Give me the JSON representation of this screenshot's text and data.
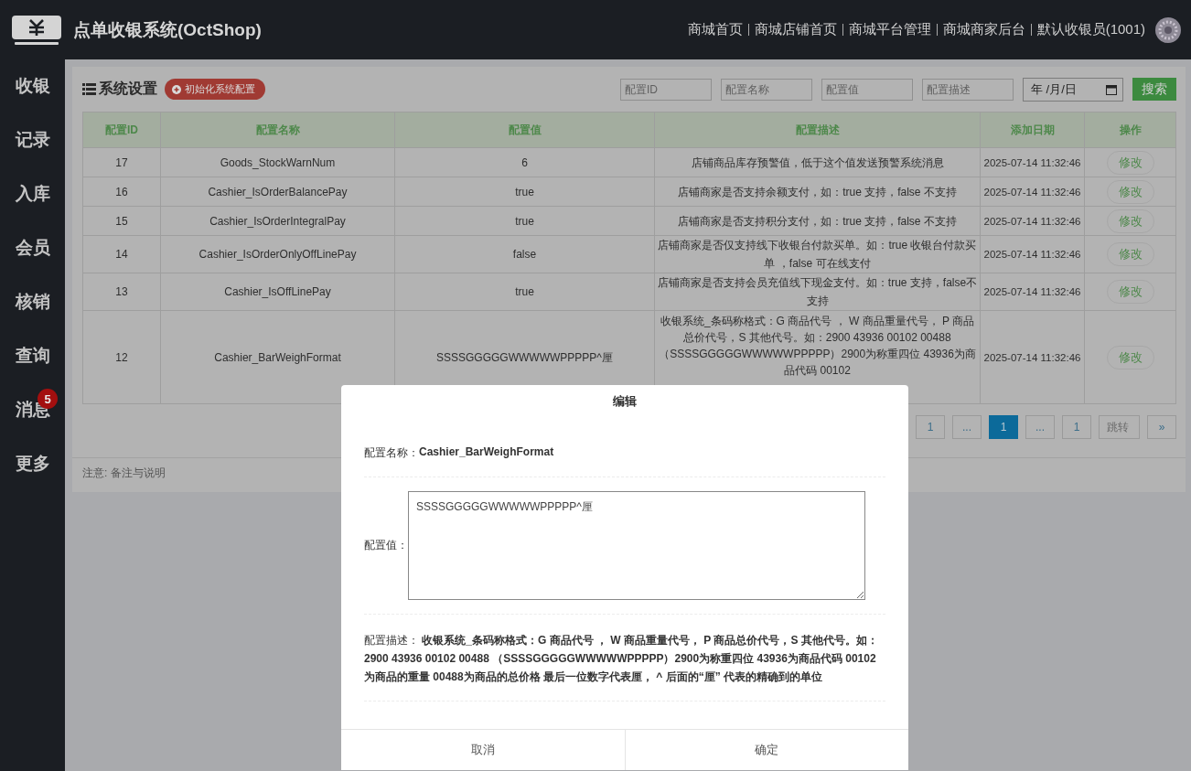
{
  "header": {
    "title": "点单收银系统(OctShop)",
    "nav": [
      "商城首页",
      "商城店铺首页",
      "商城平台管理",
      "商城商家后台",
      "默认收银员(1001)"
    ]
  },
  "sidebar": {
    "items": [
      {
        "label": "收银"
      },
      {
        "label": "记录"
      },
      {
        "label": "入库"
      },
      {
        "label": "会员"
      },
      {
        "label": "核销"
      },
      {
        "label": "查询"
      },
      {
        "label": "消息",
        "badge": "5"
      },
      {
        "label": "更多"
      }
    ]
  },
  "panel": {
    "title": "系统设置",
    "init_button": "初始化系统配置",
    "filters": [
      {
        "placeholder": "配置ID"
      },
      {
        "placeholder": "配置名称"
      },
      {
        "placeholder": "配置值"
      },
      {
        "placeholder": "配置描述"
      }
    ],
    "date_field": "年 /月/日",
    "search_button": "搜索"
  },
  "table": {
    "columns": [
      "配置ID",
      "配置名称",
      "配置值",
      "配置描述",
      "添加日期",
      "操作"
    ],
    "rows": [
      {
        "id": "17",
        "name": "Goods_StockWarnNum",
        "value": "6",
        "description": "店铺商品库存预警值，低于这个值发送预警系统消息",
        "date": "2025-07-14 11:32:46",
        "action": "修改"
      },
      {
        "id": "16",
        "name": "Cashier_IsOrderBalancePay",
        "value": "true",
        "description": "店铺商家是否支持余额支付，如：true 支持，false 不支持",
        "date": "2025-07-14 11:32:46",
        "action": "修改"
      },
      {
        "id": "15",
        "name": "Cashier_IsOrderIntegralPay",
        "value": "true",
        "description": "店铺商家是否支持积分支付，如：true 支持，false 不支持",
        "date": "2025-07-14 11:32:46",
        "action": "修改"
      },
      {
        "id": "14",
        "name": "Cashier_IsOrderOnlyOffLinePay",
        "value": "false",
        "description": "店铺商家是否仅支持线下收银台付款买单。如：true 收银台付款买单 ，false 可在线支付",
        "date": "2025-07-14 11:32:46",
        "action": "修改"
      },
      {
        "id": "13",
        "name": "Cashier_IsOffLinePay",
        "value": "true",
        "description": "店铺商家是否支持会员充值线下现金支付。如：true 支持，false不支持",
        "date": "2025-07-14 11:32:46",
        "action": "修改"
      },
      {
        "id": "12",
        "name": "Cashier_BarWeighFormat",
        "value": "SSSSGGGGGWWWWWPPPPP^厘",
        "description": "收银系统_条码称格式：G 商品代号 ， W 商品重量代号， P 商品总价代号，S 其他代号。如：2900 43936 00102 00488 （SSSSGGGGGWWWWWPPPPP）2900为称重四位 43936为商品代码 00102",
        "date": "2025-07-14 11:32:46",
        "action": "修改"
      }
    ]
  },
  "pagination": [
    {
      "label": "1",
      "selected": false
    },
    {
      "label": "...",
      "selected": false
    },
    {
      "label": "1",
      "selected": true
    },
    {
      "label": "...",
      "selected": false
    },
    {
      "label": "1",
      "selected": false
    },
    {
      "label": "跳转",
      "selected": false
    },
    {
      "label": "»",
      "selected": false
    }
  ],
  "footer_note": "注意: 备注与说明",
  "dialog": {
    "title": "编辑",
    "name_label": "配置名称：",
    "name_value": "Cashier_BarWeighFormat",
    "value_label": "配置值：",
    "value": "SSSSGGGGGWWWWWPPPPP^厘",
    "description_label": "配置描述：",
    "description_value": "收银系统_条码称格式：G 商品代号 ， W 商品重量代号， P 商品总价代号，S 其他代号。如：2900 43936 00102 00488 （SSSSGGGGGWWWWWPPPPP）2900为称重四位 43936为商品代码 00102为商品的重量 00488为商品的总价格 最后一位数字代表厘， ^ 后面的“厘” 代表的精确到的单位",
    "buttons": [
      "取消",
      "确定"
    ]
  }
}
